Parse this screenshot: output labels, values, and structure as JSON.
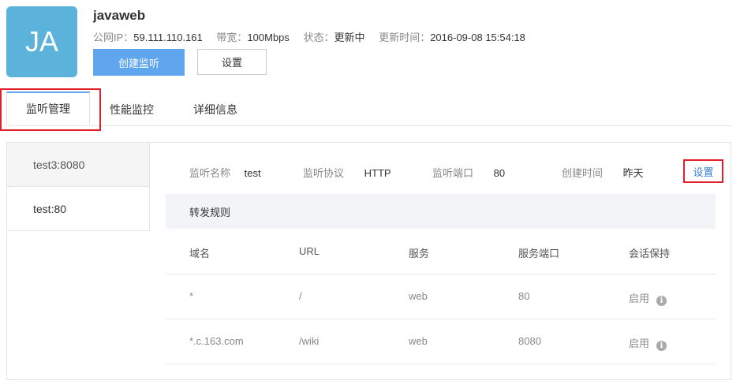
{
  "instance": {
    "avatar_text": "JA",
    "name": "javaweb",
    "ip_label": "公网IP：",
    "ip_value": "59.111.110.161",
    "bandwidth_label": "带宽：",
    "bandwidth_value": "100Mbps",
    "status_label": "状态：",
    "status_value": "更新中",
    "updated_label": "更新时间：",
    "updated_value": "2016-09-08 15:54:18"
  },
  "actions": {
    "create_listener": "创建监听",
    "settings": "设置"
  },
  "tabs": [
    {
      "label": "监听管理",
      "active": true
    },
    {
      "label": "性能监控",
      "active": false
    },
    {
      "label": "详细信息",
      "active": false
    }
  ],
  "listeners": [
    {
      "label": "test3:8080",
      "active": true
    },
    {
      "label": "test:80",
      "active": false
    }
  ],
  "detail": {
    "name_label": "监听名称",
    "name_value": "test",
    "protocol_label": "监听协议",
    "protocol_value": "HTTP",
    "port_label": "监听端口",
    "port_value": "80",
    "created_label": "创建时间",
    "created_value": "昨天",
    "settings_link": "设置"
  },
  "rules": {
    "title": "转发规则",
    "columns": [
      "域名",
      "URL",
      "服务",
      "服务端口",
      "会话保持"
    ],
    "rows": [
      {
        "domain": "*",
        "url": "/",
        "service": "web",
        "port": "80",
        "session": "启用"
      },
      {
        "domain": "*.c.163.com",
        "url": "/wiki",
        "service": "web",
        "port": "8080",
        "session": "启用"
      }
    ]
  },
  "colors": {
    "avatar": "#5bb2da",
    "primary": "#5fa6ef",
    "highlight": "#e0202a",
    "link": "#3a7fd5"
  }
}
